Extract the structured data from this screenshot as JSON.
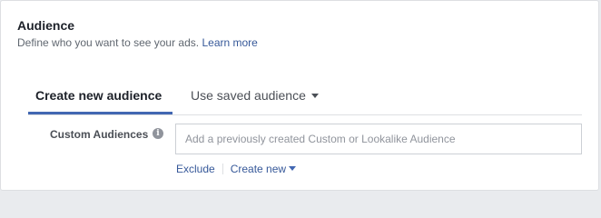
{
  "header": {
    "title": "Audience",
    "subtitle": "Define who you want to see your ads.",
    "learn_more": "Learn more"
  },
  "tabs": [
    {
      "label": "Create new audience",
      "active": true
    },
    {
      "label": "Use saved audience",
      "active": false,
      "icon": "caret-down-icon"
    }
  ],
  "custom_audiences": {
    "label": "Custom Audiences",
    "info_icon": "info-icon",
    "info_glyph": "i",
    "input": {
      "value": "",
      "placeholder": "Add a previously created Custom or Lookalike Audience"
    },
    "exclude_label": "Exclude",
    "create_new_label": "Create new"
  },
  "colors": {
    "accent": "#4267b2",
    "link": "#365899",
    "border": "#dddfe2",
    "background": "#e9ebee"
  }
}
